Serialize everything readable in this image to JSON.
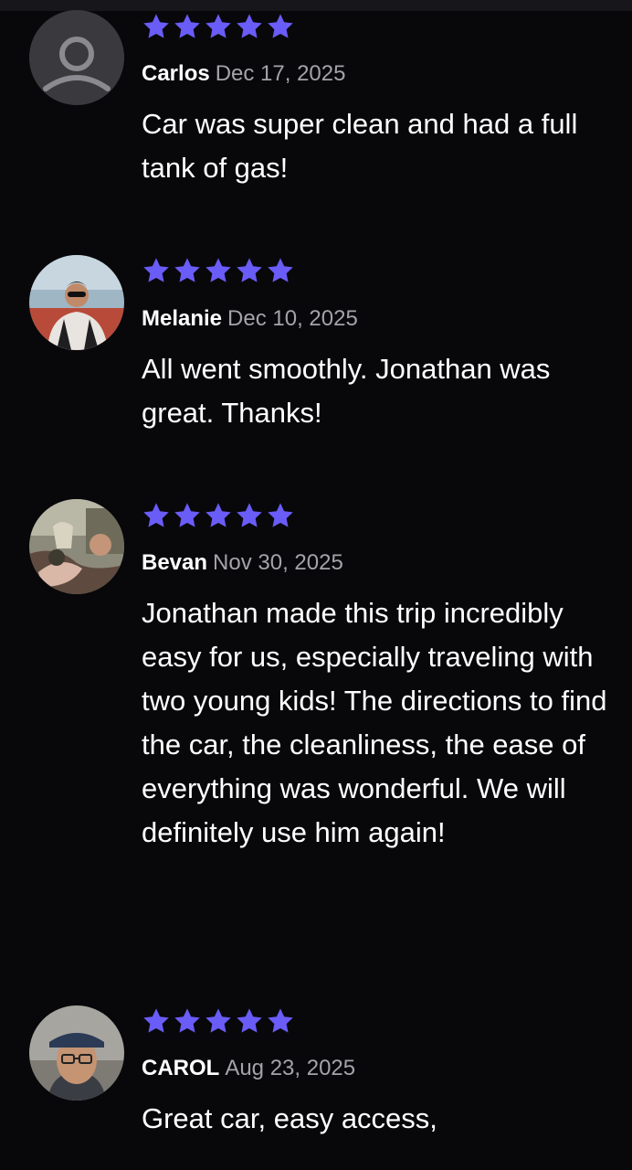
{
  "theme": {
    "background": "#08080b",
    "star_color": "#6a5cf7",
    "date_color": "#a3a3a8"
  },
  "reviews": [
    {
      "reviewer": "Carlos",
      "date": "Dec 17, 2025",
      "rating": 5,
      "text": "Car was super clean and had a full tank of gas!",
      "avatar": "default-user-icon"
    },
    {
      "reviewer": "Melanie",
      "date": "Dec 10, 2025",
      "rating": 5,
      "text": "All went smoothly. Jonathan was great. Thanks!",
      "avatar": "user-photo"
    },
    {
      "reviewer": "Bevan",
      "date": "Nov 30, 2025",
      "rating": 5,
      "text": "Jonathan made this trip incredibly easy for us, especially traveling with two young kids! The directions to find the car, the cleanliness, the ease of everything was wonderful. We will definitely use him again!",
      "avatar": "user-photo"
    },
    {
      "reviewer": "CAROL",
      "date": "Aug 23, 2025",
      "rating": 5,
      "text": "Great car, easy access,",
      "avatar": "user-photo"
    }
  ]
}
